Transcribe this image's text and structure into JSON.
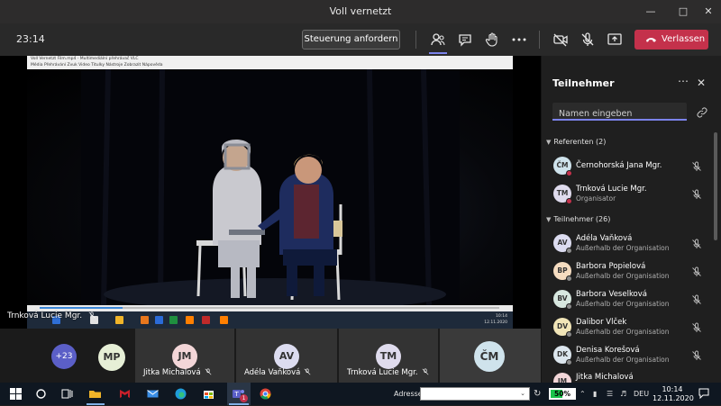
{
  "window": {
    "title": "Voll vernetzt"
  },
  "toolbar": {
    "elapsed": "23:14",
    "request_control_label": "Steuerung anfordern",
    "leave_label": "Verlassen",
    "icons": [
      "participants-icon",
      "chat-icon",
      "raise-hand-icon",
      "more-icon",
      "camera-off-icon",
      "mic-off-icon",
      "share-icon",
      "leave-phone-icon"
    ]
  },
  "shared_screen": {
    "window_title": "Voll Vernetzt Film.mp4 - Multimediální přehrávač VLC",
    "menu": "Média  Přehrávání  Zvuk  Video  Titulky  Nástroje  Zobrazit  Nápověda",
    "playback_progress": 0.18,
    "inner_clock_time": "10:14",
    "inner_clock_date": "12.11.2020",
    "presenter_label": "Trnková Lucie Mgr."
  },
  "strip": {
    "overflow_count": "+23",
    "tiles": [
      {
        "initials": "MP",
        "name": "",
        "color": "#e6efd6"
      },
      {
        "initials": "JM",
        "name": "Jitka Michalová",
        "color": "#f3d6d8"
      },
      {
        "initials": "AV",
        "name": "Adéla Vaňková",
        "color": "#dcdcf0"
      },
      {
        "initials": "TM",
        "name": "Trnková Lucie Mgr.",
        "color": "#dfdbed"
      },
      {
        "initials": "ČM",
        "name": "",
        "color": "#cfe3ec"
      }
    ]
  },
  "panel": {
    "title": "Teilnehmer",
    "search_placeholder": "Namen eingeben",
    "presenters_header": "Referenten (2)",
    "participants_header": "Teilnehmer (26)",
    "presenters": [
      {
        "initials": "ČM",
        "name": "Černohorská Jana Mgr.",
        "sub": "",
        "color": "#cfe3ec",
        "status": "#c4314b"
      },
      {
        "initials": "TM",
        "name": "Trnková Lucie Mgr.",
        "sub": "Organisator",
        "color": "#dfdbed",
        "status": "#c4314b"
      }
    ],
    "participants": [
      {
        "initials": "AV",
        "name": "Adéla Vaňková",
        "sub": "Außerhalb der Organisation",
        "color": "#dcdcf0",
        "status": "#8a8a8a"
      },
      {
        "initials": "BP",
        "name": "Barbora Popielová",
        "sub": "Außerhalb der Organisation",
        "color": "#f5dcc0",
        "status": "#8a8a8a"
      },
      {
        "initials": "BV",
        "name": "Barbora Veselková",
        "sub": "Außerhalb der Organisation",
        "color": "#d8e8e0",
        "status": "#8a8a8a"
      },
      {
        "initials": "DV",
        "name": "Dalibor Vlček",
        "sub": "Außerhalb der Organisation",
        "color": "#f2e6b8",
        "status": "#8a8a8a"
      },
      {
        "initials": "DK",
        "name": "Denisa Korešová",
        "sub": "Außerhalb der Organisation",
        "color": "#dce6ee",
        "status": "#8a8a8a"
      },
      {
        "initials": "JM",
        "name": "Jitka Michalová",
        "sub": "",
        "color": "#f3d6d8",
        "status": "#8a8a8a"
      }
    ]
  },
  "taskbar": {
    "address_label": "Adresse",
    "battery_percent": "50%",
    "battery_level": 0.5,
    "language": "DEU",
    "time": "10:14",
    "date": "12.11.2020",
    "teams_badge": "1"
  }
}
